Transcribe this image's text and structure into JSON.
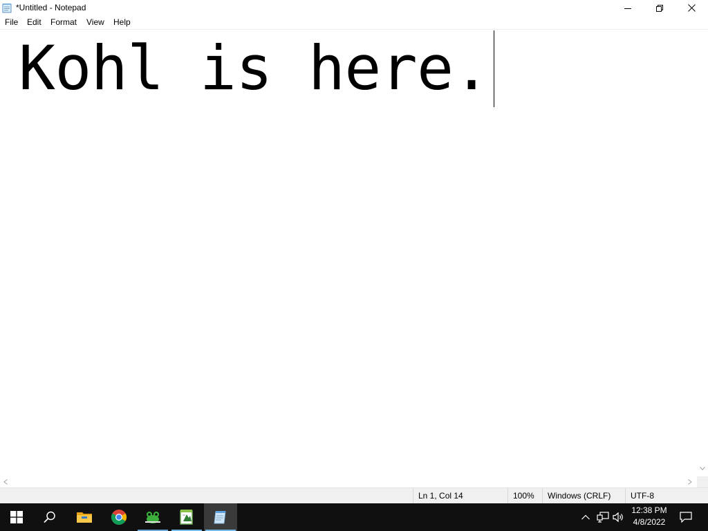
{
  "window": {
    "title": "*Untitled - Notepad",
    "minimize_icon": "minimize-icon",
    "restore_icon": "restore-icon",
    "close_icon": "close-icon"
  },
  "menu": {
    "items": [
      {
        "label": "File"
      },
      {
        "label": "Edit"
      },
      {
        "label": "Format"
      },
      {
        "label": "View"
      },
      {
        "label": "Help"
      }
    ]
  },
  "editor": {
    "content": "Kohl is here."
  },
  "statusbar": {
    "position": "Ln 1, Col 14",
    "zoom": "100%",
    "line_ending": "Windows (CRLF)",
    "encoding": "UTF-8"
  },
  "taskbar": {
    "items": [
      {
        "icon": "windows-start-icon"
      },
      {
        "icon": "search-icon"
      },
      {
        "icon": "file-explorer-icon"
      },
      {
        "icon": "chrome-icon"
      },
      {
        "icon": "frog-app-icon"
      },
      {
        "icon": "notepad-plus-plus-icon"
      },
      {
        "icon": "notepad-icon",
        "active": true
      }
    ],
    "tray": {
      "time": "12:38 PM",
      "date": "4/8/2022"
    }
  },
  "colors": {
    "taskbar_bg": "#101010",
    "active_underline": "#76b9ed",
    "statusbar_bg": "#f0f0f0"
  }
}
